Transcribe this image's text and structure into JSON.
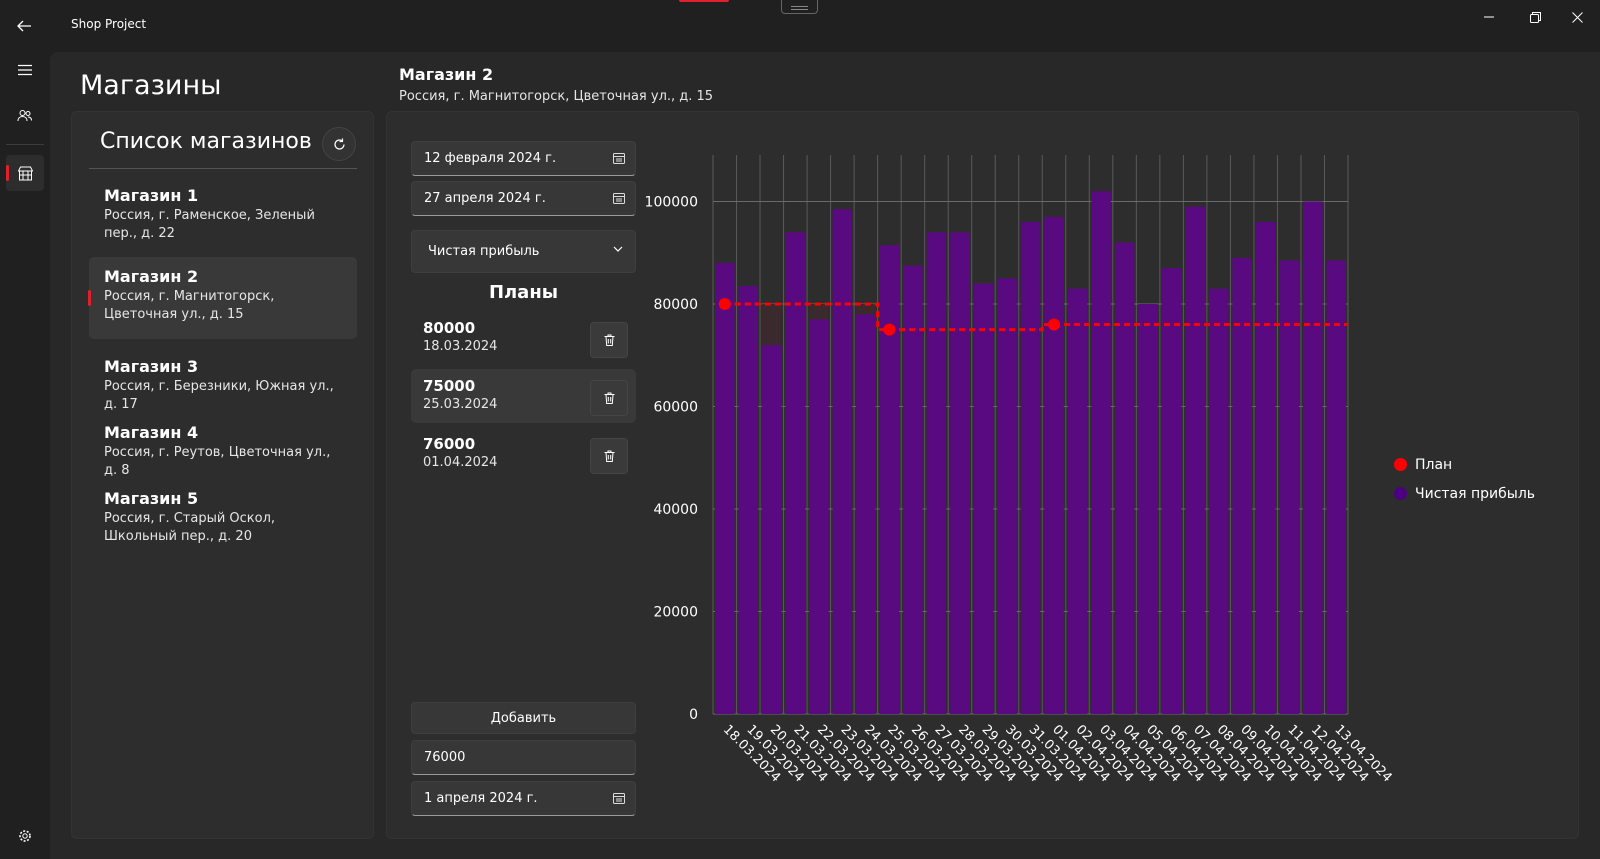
{
  "app": {
    "title": "Shop Project"
  },
  "nav": {
    "items": [
      {
        "icon": "hamburger-menu-icon"
      },
      {
        "icon": "people-icon"
      },
      {
        "icon": "store-icon",
        "selected": true
      },
      {
        "icon": "gear-icon"
      }
    ]
  },
  "page": {
    "title": "Магазины"
  },
  "shop_list": {
    "title": "Список магазинов",
    "items": [
      {
        "name": "Магазин 1",
        "address": "Россия, г. Раменское, Зеленый пер., д. 22"
      },
      {
        "name": "Магазин 2",
        "address": "Россия, г. Магнитогорск, Цветочная ул., д. 15"
      },
      {
        "name": "Магазин 3",
        "address": "Россия, г. Березники, Южная ул., д. 17"
      },
      {
        "name": "Магазин 4",
        "address": "Россия, г. Реутов, Цветочная ул., д. 8"
      },
      {
        "name": "Магазин 5",
        "address": "Россия, г. Старый Оскол, Школьный пер., д. 20"
      }
    ],
    "selected_index": 1
  },
  "selected_shop": {
    "name": "Магазин 2",
    "address": "Россия, г. Магнитогорск, Цветочная ул., д. 15"
  },
  "filters": {
    "date_from": "12 февраля 2024 г.",
    "date_to": "27 апреля 2024 г.",
    "metric": "Чистая прибыль"
  },
  "plans": {
    "title": "Планы",
    "items": [
      {
        "value": "80000",
        "date": "18.03.2024"
      },
      {
        "value": "75000",
        "date": "25.03.2024"
      },
      {
        "value": "76000",
        "date": "01.04.2024"
      }
    ]
  },
  "add_form": {
    "button_label": "Добавить",
    "value": "76000",
    "date": "1 апреля 2024 г."
  },
  "colors": {
    "accent": "#e0202a",
    "bar": "#5a0a80",
    "plan": "#ff0000",
    "legend_profit": "#4b0082"
  },
  "chart_data": {
    "type": "bar",
    "categories": [
      "18.03.2024",
      "19.03.2024",
      "20.03.2024",
      "21.03.2024",
      "22.03.2024",
      "23.03.2024",
      "24.03.2024",
      "25.03.2024",
      "26.03.2024",
      "27.03.2024",
      "28.03.2024",
      "29.03.2024",
      "30.03.2024",
      "31.03.2024",
      "01.04.2024",
      "02.04.2024",
      "03.04.2024",
      "04.04.2024",
      "05.04.2024",
      "06.04.2024",
      "07.04.2024",
      "08.04.2024",
      "09.04.2024",
      "10.04.2024",
      "11.04.2024",
      "12.04.2024",
      "13.04.2024"
    ],
    "series": [
      {
        "name": "Чистая прибыль",
        "type": "bar",
        "values": [
          88000,
          83500,
          72000,
          94000,
          77000,
          98500,
          78000,
          91500,
          87500,
          94000,
          94000,
          84000,
          85000,
          96000,
          97000,
          83000,
          102000,
          92000,
          80000,
          87000,
          99000,
          83000,
          89000,
          96000,
          88500,
          100000,
          88500
        ]
      },
      {
        "name": "План",
        "type": "step",
        "values": [
          80000,
          80000,
          80000,
          80000,
          80000,
          80000,
          80000,
          75000,
          75000,
          75000,
          75000,
          75000,
          75000,
          75000,
          76000,
          76000,
          76000,
          76000,
          76000,
          76000,
          76000,
          76000,
          76000,
          76000,
          76000,
          76000,
          76000
        ],
        "markers": [
          {
            "x": "18.03.2024",
            "y": 80000
          },
          {
            "x": "25.03.2024",
            "y": 75000
          },
          {
            "x": "01.04.2024",
            "y": 76000
          }
        ]
      }
    ],
    "yticks": [
      0,
      20000,
      40000,
      60000,
      80000,
      100000
    ],
    "ylim": [
      0,
      112000
    ],
    "grid": true,
    "legend": "right"
  }
}
